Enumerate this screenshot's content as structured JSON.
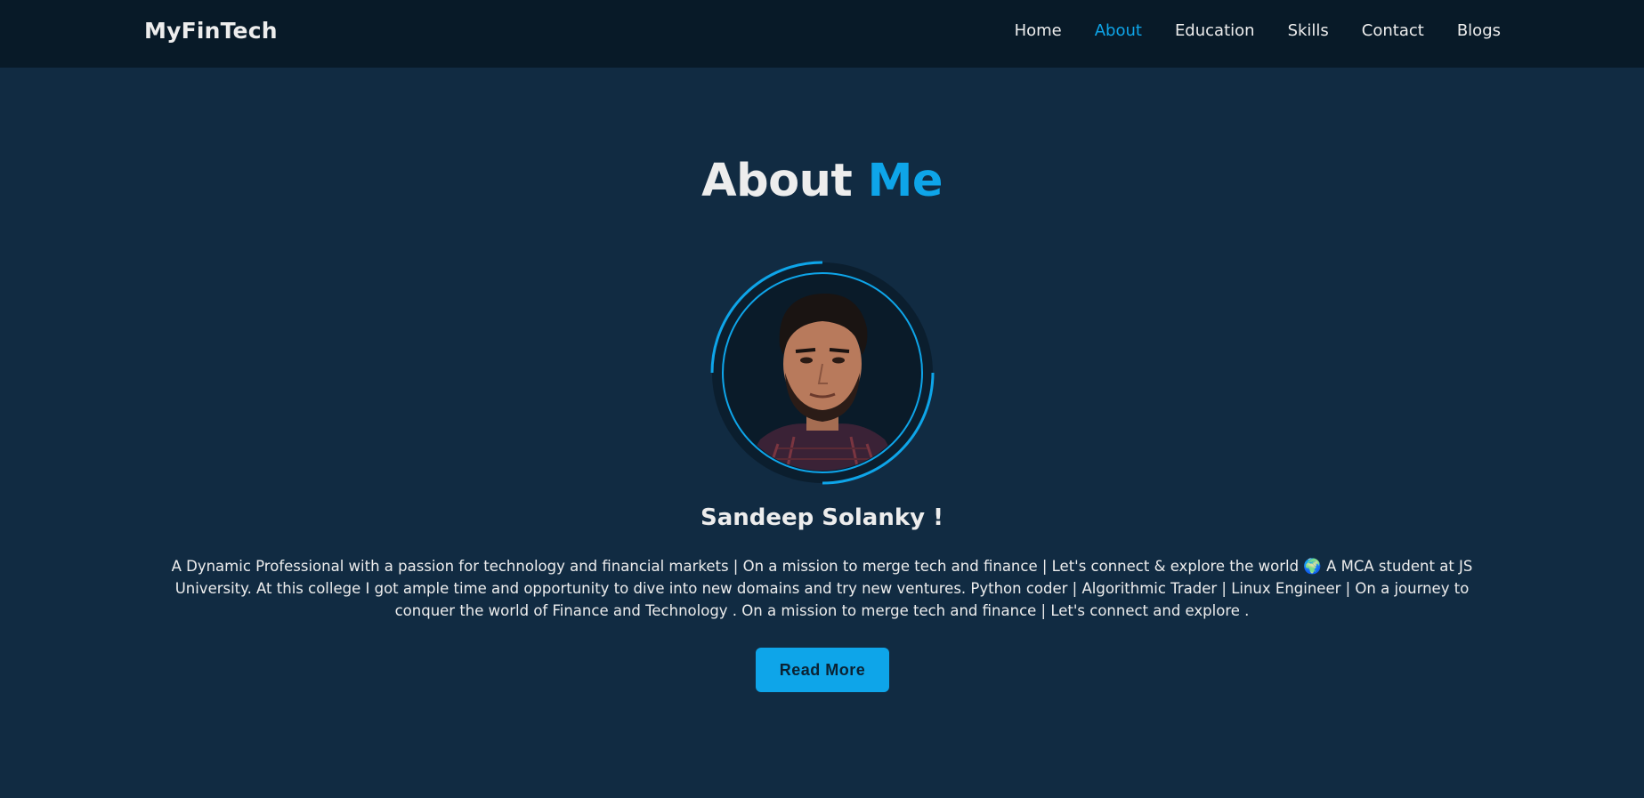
{
  "header": {
    "logo": "MyFinTech",
    "nav": [
      {
        "label": "Home",
        "active": false
      },
      {
        "label": "About",
        "active": true
      },
      {
        "label": "Education",
        "active": false
      },
      {
        "label": "Skills",
        "active": false
      },
      {
        "label": "Contact",
        "active": false
      },
      {
        "label": "Blogs",
        "active": false
      }
    ]
  },
  "about": {
    "title_main": "About",
    "title_accent": "Me",
    "name": "Sandeep Solanky !",
    "bio": "A Dynamic Professional with a passion for technology and financial markets | On a mission to merge tech and finance | Let's connect & explore the world 🌍 A MCA student at JS University. At this college I got ample time and opportunity to dive into new domains and try new ventures. Python coder | Algorithmic Trader | Linux Engineer | On a journey to conquer the world of Finance and Technology . On a mission to merge tech and finance | Let's connect and explore .",
    "button_label": "Read More"
  },
  "colors": {
    "accent": "#0ea5e9",
    "background": "#112b42",
    "header_bg": "#081a28"
  }
}
